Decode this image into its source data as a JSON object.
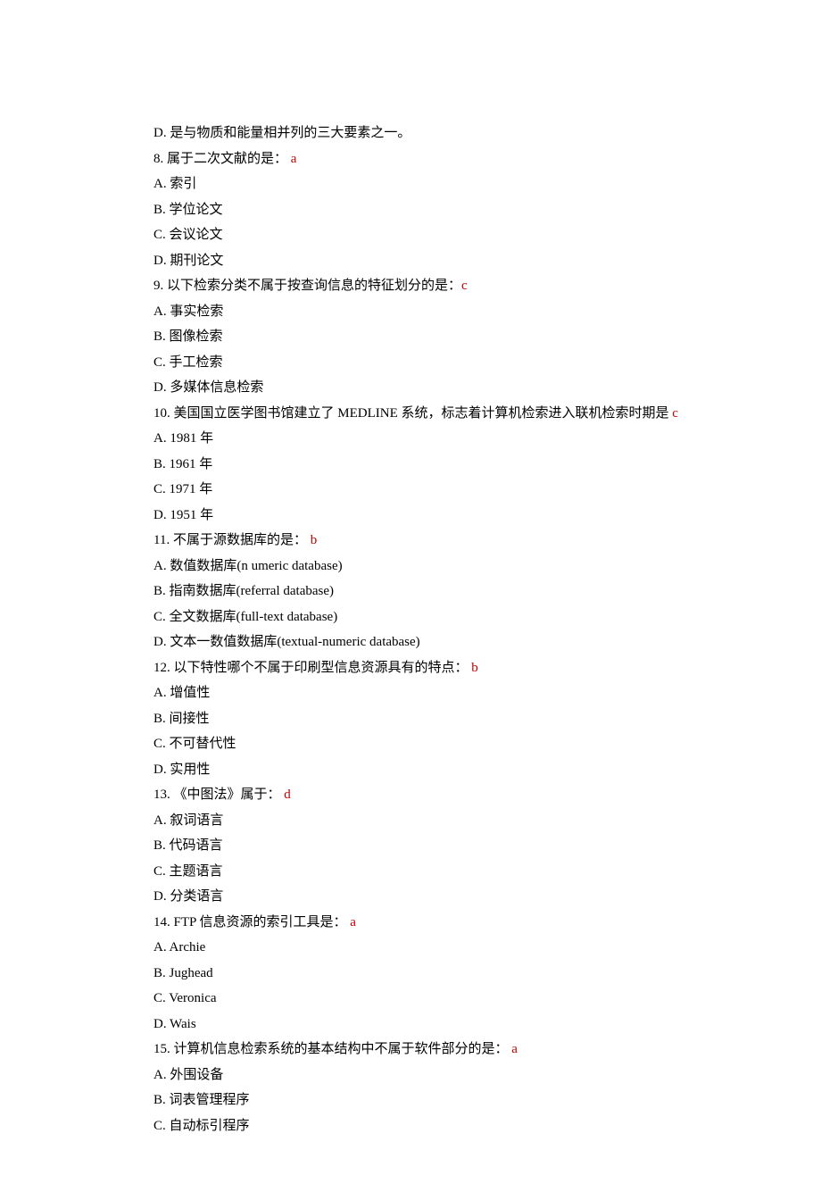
{
  "lines": [
    {
      "segments": [
        {
          "text": "D.  是与物质和能量相并列的三大要素之一。"
        }
      ]
    },
    {
      "segments": [
        {
          "text": "8.  属于二次文献的是：  "
        },
        {
          "text": "a",
          "answer": true
        }
      ]
    },
    {
      "segments": [
        {
          "text": "A.  索引"
        }
      ]
    },
    {
      "segments": [
        {
          "text": "B.  学位论文"
        }
      ]
    },
    {
      "segments": [
        {
          "text": "C.  会议论文"
        }
      ]
    },
    {
      "segments": [
        {
          "text": "D.  期刊论文"
        }
      ]
    },
    {
      "segments": [
        {
          "text": "9.  以下检索分类不属于按查询信息的特征划分的是："
        },
        {
          "text": "c",
          "answer": true
        }
      ]
    },
    {
      "segments": [
        {
          "text": "A.  事实检索"
        }
      ]
    },
    {
      "segments": [
        {
          "text": "B.  图像检索"
        }
      ]
    },
    {
      "segments": [
        {
          "text": "C.  手工检索"
        }
      ]
    },
    {
      "segments": [
        {
          "text": "D.  多媒体信息检索"
        }
      ]
    },
    {
      "segments": [
        {
          "text": "10.  美国国立医学图书馆建立了 MEDLINE 系统，标志着计算机检索进入联机检索时期是 "
        },
        {
          "text": "c",
          "answer": true
        }
      ]
    },
    {
      "segments": [
        {
          "text": "A.  1981 年"
        }
      ]
    },
    {
      "segments": [
        {
          "text": "B.  1961 年"
        }
      ]
    },
    {
      "segments": [
        {
          "text": "C.  1971 年"
        }
      ]
    },
    {
      "segments": [
        {
          "text": "D.  1951 年"
        }
      ]
    },
    {
      "segments": [
        {
          "text": "11.  不属于源数据库的是：  "
        },
        {
          "text": "b",
          "answer": true
        }
      ]
    },
    {
      "segments": [
        {
          "text": "A.  数值数据库(n umeric database)"
        }
      ]
    },
    {
      "segments": [
        {
          "text": "B.  指南数据库(referral database)"
        }
      ]
    },
    {
      "segments": [
        {
          "text": "C.  全文数据库(full-text database)"
        }
      ]
    },
    {
      "segments": [
        {
          "text": "D.  文本一数值数据库(textual-numeric database)"
        }
      ]
    },
    {
      "segments": [
        {
          "text": "12.  以下特性哪个不属于印刷型信息资源具有的特点：  "
        },
        {
          "text": "b",
          "answer": true
        }
      ]
    },
    {
      "segments": [
        {
          "text": "A.  增值性"
        }
      ]
    },
    {
      "segments": [
        {
          "text": "B.  间接性"
        }
      ]
    },
    {
      "segments": [
        {
          "text": "C.  不可替代性"
        }
      ]
    },
    {
      "segments": [
        {
          "text": "D.  实用性"
        }
      ]
    },
    {
      "segments": [
        {
          "text": "13.  《中图法》属于：  "
        },
        {
          "text": "d",
          "answer": true
        }
      ]
    },
    {
      "segments": [
        {
          "text": "A.  叙词语言"
        }
      ]
    },
    {
      "segments": [
        {
          "text": "B.  代码语言"
        }
      ]
    },
    {
      "segments": [
        {
          "text": "C.  主题语言"
        }
      ]
    },
    {
      "segments": [
        {
          "text": "D.  分类语言"
        }
      ]
    },
    {
      "segments": [
        {
          "text": "14.  FTP 信息资源的索引工具是：  "
        },
        {
          "text": "a",
          "answer": true
        }
      ]
    },
    {
      "segments": [
        {
          "text": "A.  Archie"
        }
      ]
    },
    {
      "segments": [
        {
          "text": "B.  Jughead"
        }
      ]
    },
    {
      "segments": [
        {
          "text": "C.  Veronica"
        }
      ]
    },
    {
      "segments": [
        {
          "text": "D.  Wais"
        }
      ]
    },
    {
      "segments": [
        {
          "text": "15.  计算机信息检索系统的基本结构中不属于软件部分的是：  "
        },
        {
          "text": "a",
          "answer": true
        }
      ]
    },
    {
      "segments": [
        {
          "text": "A.  外围设备"
        }
      ]
    },
    {
      "segments": [
        {
          "text": "B.  词表管理程序"
        }
      ]
    },
    {
      "segments": [
        {
          "text": "C.  自动标引程序"
        }
      ]
    }
  ]
}
